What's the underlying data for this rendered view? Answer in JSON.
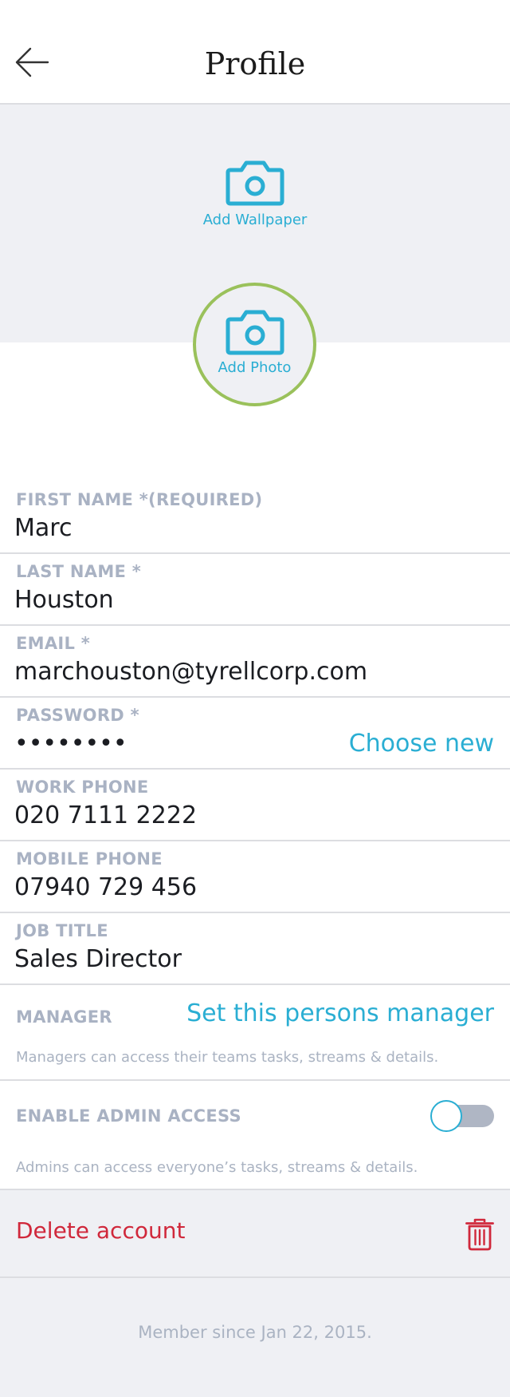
{
  "header": {
    "title": "Profile",
    "back_icon": "arrow-left-icon"
  },
  "cover": {
    "wallpaper_label": "Add Wallpaper",
    "wallpaper_icon": "camera-icon"
  },
  "avatar": {
    "label": "Add Photo",
    "icon": "camera-icon",
    "ring_color": "#9ac15b"
  },
  "fields": {
    "first_name": {
      "label": "FIRST NAME *(REQUIRED)",
      "value": "Marc"
    },
    "last_name": {
      "label": "LAST NAME *",
      "value": "Houston"
    },
    "email": {
      "label": "EMAIL *",
      "value": "marchouston@tyrellcorp.com"
    },
    "password": {
      "label": "PASSWORD *",
      "value": "••••••••",
      "action": "Choose new"
    },
    "work_phone": {
      "label": "WORK PHONE",
      "value": "020 7111 2222"
    },
    "mobile_phone": {
      "label": "MOBILE PHONE",
      "value": "07940 729 456"
    },
    "job_title": {
      "label": "JOB TITLE",
      "value": "Sales Director"
    }
  },
  "manager": {
    "label": "MANAGER",
    "action": "Set this persons manager",
    "help": "Managers can access their teams tasks, streams & details."
  },
  "admin": {
    "label": "ENABLE ADMIN ACCESS",
    "enabled": false,
    "help": "Admins can access everyone’s tasks, streams & details."
  },
  "danger": {
    "delete_label": "Delete account",
    "icon": "trash-icon"
  },
  "footer": {
    "member_since": "Member since Jan 22, 2015."
  },
  "colors": {
    "accent": "#2aaed3",
    "danger": "#d0283b",
    "avatar_ring": "#9ac15b",
    "label": "#a9b2c3"
  }
}
